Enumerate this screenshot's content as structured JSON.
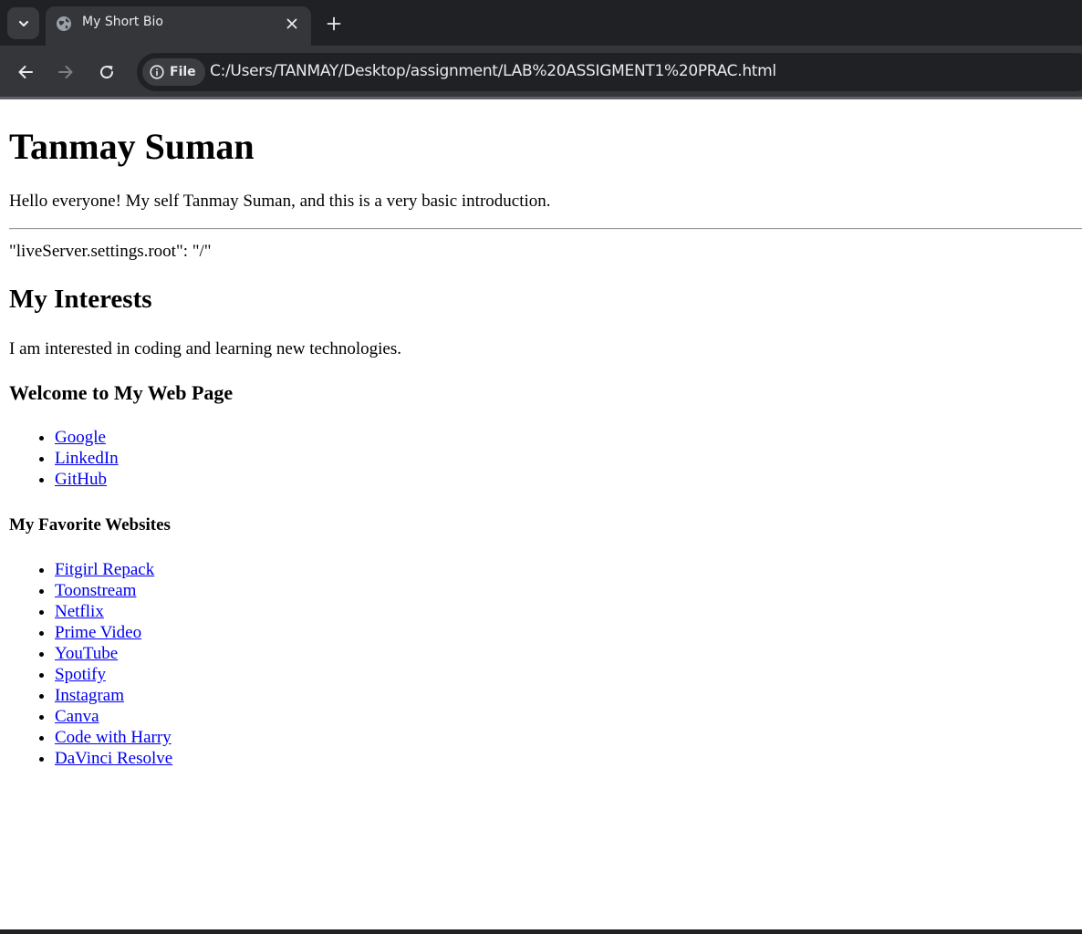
{
  "browser": {
    "tab_title": "My Short Bio",
    "chip_label": "File",
    "url": "C:/Users/TANMAY/Desktop/assignment/LAB%20ASSIGMENT1%20PRAC.html",
    "icons": {
      "tab_search": "chevron-down-icon",
      "favicon": "globe-icon",
      "close": "close-icon",
      "new_tab": "plus-icon",
      "back": "back-arrow-icon",
      "forward": "forward-arrow-icon",
      "reload": "reload-icon",
      "info": "info-icon"
    }
  },
  "page": {
    "name_heading": "Tanmay Suman",
    "intro": "Hello everyone! My self Tanmay Suman, and this is a very basic introduction.",
    "settings_line": "\"liveServer.settings.root\": \"/\"",
    "interests_heading": "My Interests",
    "interests_text": "I am interested in coding and learning new technologies.",
    "welcome_heading": "Welcome to My Web Page",
    "welcome_links": [
      "Google",
      "LinkedIn",
      "GitHub"
    ],
    "favorites_heading": "My Favorite Websites",
    "favorite_links": [
      "Fitgirl Repack",
      "Toonstream",
      "Netflix",
      "Prime Video",
      "YouTube",
      "Spotify",
      "Instagram",
      "Canva",
      "Code with Harry",
      "DaVinci Resolve"
    ]
  }
}
